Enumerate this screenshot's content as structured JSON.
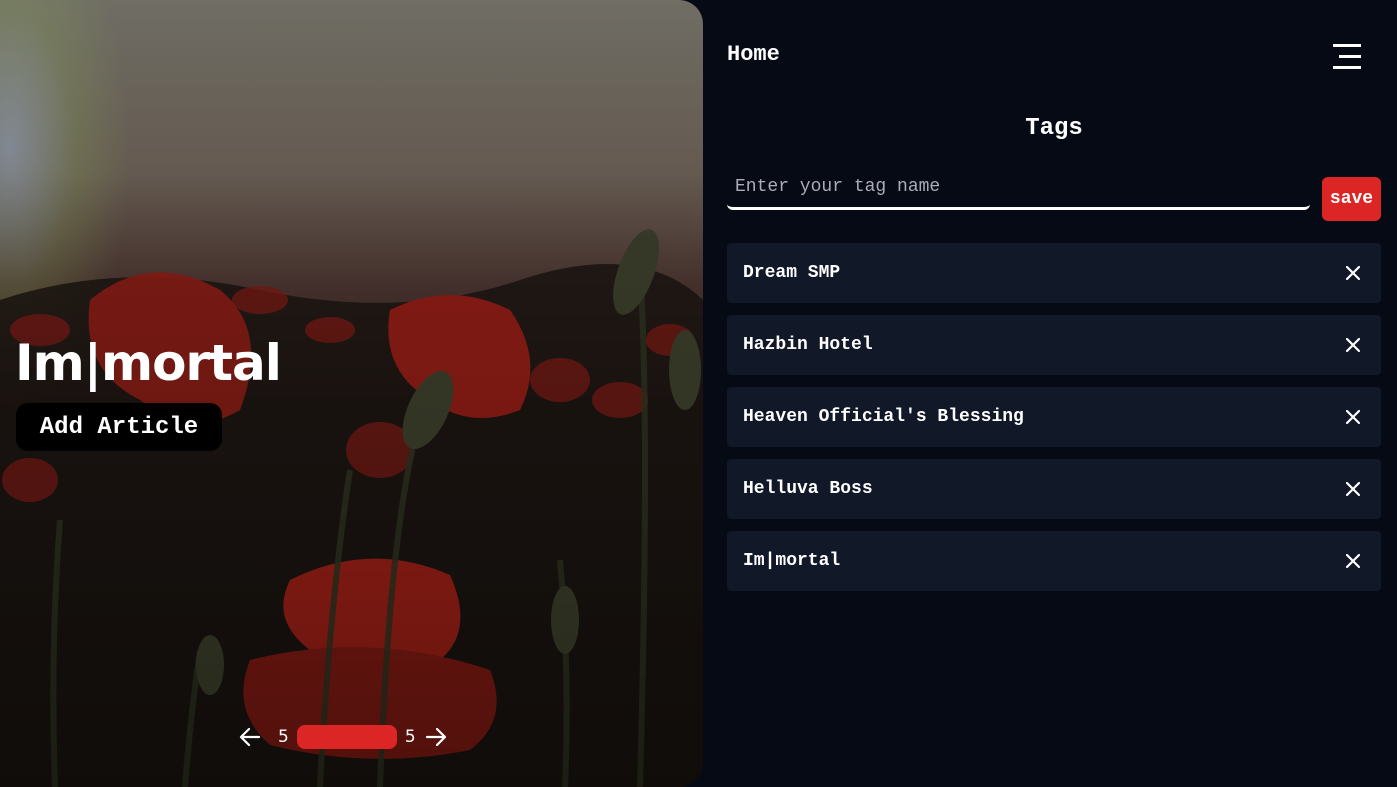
{
  "hero": {
    "title": "Im|mortal",
    "add_article_label": "Add Article",
    "pager": {
      "prev_icon": "arrow-left-icon",
      "current": "5",
      "total": "5",
      "next_icon": "arrow-right-icon",
      "progress": 1.0,
      "accent": "#dc2626"
    }
  },
  "header": {
    "home_label": "Home",
    "menu_icon": "hamburger-menu-icon"
  },
  "tags": {
    "title": "Tags",
    "input": {
      "value": "",
      "placeholder": "Enter your tag name"
    },
    "save_label": "save",
    "items": [
      {
        "label": "Dream SMP"
      },
      {
        "label": "Hazbin Hotel"
      },
      {
        "label": "Heaven Official's Blessing"
      },
      {
        "label": "Helluva Boss"
      },
      {
        "label": "Im|mortal"
      }
    ],
    "remove_icon": "close-icon"
  },
  "colors": {
    "background": "#050a14",
    "card": "#111827",
    "accent": "#dc2626"
  }
}
